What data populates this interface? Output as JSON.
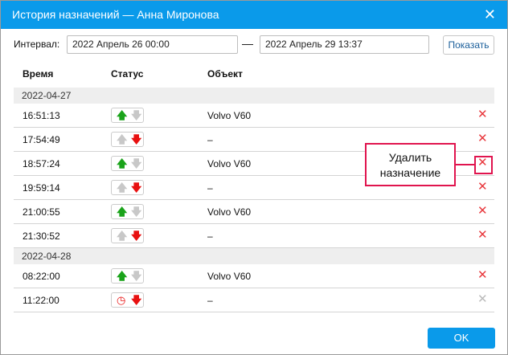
{
  "title": "История назначений — Анна Миронова",
  "interval_label": "Интервал:",
  "from": "2022 Апрель 26 00:00",
  "to": "2022 Апрель 29 13:37",
  "separator": "—",
  "show_label": "Показать",
  "columns": {
    "time": "Время",
    "status": "Статус",
    "object": "Объект"
  },
  "groups": [
    {
      "date": "2022-04-27",
      "rows": [
        {
          "time": "16:51:13",
          "status": "assigned",
          "object": "Volvo V60",
          "deletable": true
        },
        {
          "time": "17:54:49",
          "status": "unassigned",
          "object": "–",
          "deletable": true
        },
        {
          "time": "18:57:24",
          "status": "assigned",
          "object": "Volvo V60",
          "deletable": true
        },
        {
          "time": "19:59:14",
          "status": "unassigned",
          "object": "–",
          "deletable": true
        },
        {
          "time": "21:00:55",
          "status": "assigned",
          "object": "Volvo V60",
          "deletable": true
        },
        {
          "time": "21:30:52",
          "status": "unassigned",
          "object": "–",
          "deletable": true
        }
      ]
    },
    {
      "date": "2022-04-28",
      "rows": [
        {
          "time": "08:22:00",
          "status": "assigned",
          "object": "Volvo V60",
          "deletable": true
        },
        {
          "time": "11:22:00",
          "status": "scheduled-unassigned",
          "object": "–",
          "deletable": false
        }
      ]
    }
  ],
  "callout": {
    "line1": "Удалить",
    "line2": "назначение"
  },
  "ok_label": "OK",
  "colors": {
    "accent": "#0a9aea",
    "up": "#1aa31a",
    "down": "#e81010",
    "inactive": "#c8c8c8",
    "delete": "#e8383d",
    "callout": "#e0144e"
  }
}
